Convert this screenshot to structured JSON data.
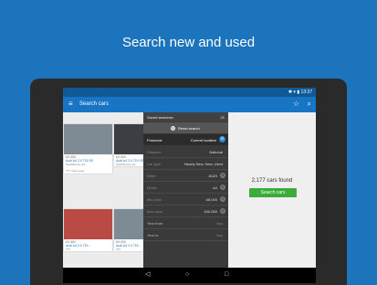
{
  "headline": "Search new and used",
  "status_bar": {
    "time": "13:37"
  },
  "app_bar": {
    "title": "Search cars"
  },
  "results": [
    {
      "price": "£9,300",
      "name": "Audi A4 2.0 TDI SE",
      "desc": "Southbrook, Ad...",
      "foot": "??? miles away",
      "tone": "grey"
    },
    {
      "price": "£9,300",
      "name": "Audi A4 2.0 TDI SE",
      "desc": "Southbrook, Ad...",
      "foot": "",
      "tone": "dark"
    },
    {
      "price": "£9,300",
      "name": "Audi A4 2.0 TDI...",
      "desc": "???",
      "foot": "",
      "tone": "red"
    },
    {
      "price": "£9,300",
      "name": "Audi A4 2.0 TDI...",
      "desc": "???",
      "foot": "",
      "tone": "grey"
    }
  ],
  "filters": {
    "saved_searches_label": "Saved searches",
    "saved_searches_count": "21",
    "reset_label": "Reset search",
    "postcode_label": "Postcode",
    "postcode_value": "Current location",
    "rows": [
      {
        "label": "Distance",
        "value": "National",
        "clear": false,
        "active": false
      },
      {
        "label": "Car type",
        "value": "Nearly New, New, Used",
        "clear": false,
        "active": false
      },
      {
        "label": "Make",
        "value": "AUDI",
        "clear": true,
        "active": false
      },
      {
        "label": "Model",
        "value": "A4",
        "clear": true,
        "active": false
      },
      {
        "label": "Min price",
        "value": "£8,000",
        "clear": true,
        "active": false
      },
      {
        "label": "Max price",
        "value": "£40,000",
        "clear": true,
        "active": false
      },
      {
        "label": "Year from",
        "value": "Any",
        "clear": false,
        "active": true
      },
      {
        "label": "Year to",
        "value": "Any",
        "clear": false,
        "active": true
      }
    ]
  },
  "summary": {
    "cars_found": "2,177 cars found",
    "search_button": "Search cars"
  },
  "colors": {
    "primary": "#1775c4",
    "accent_green": "#3bab3a",
    "background": "#1c74bd"
  }
}
